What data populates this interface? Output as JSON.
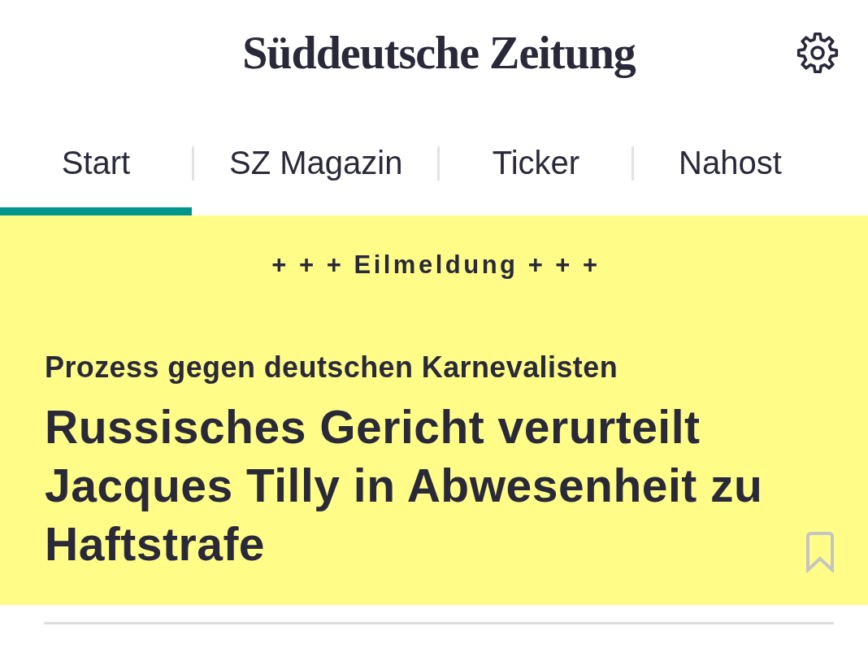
{
  "header": {
    "logo": "Süddeutsche Zeitung"
  },
  "tabs": [
    {
      "label": "Start",
      "selected": true
    },
    {
      "label": "SZ Magazin",
      "selected": false
    },
    {
      "label": "Ticker",
      "selected": false
    },
    {
      "label": "Nahost",
      "selected": false
    }
  ],
  "breaking_news": {
    "banner": "+ + + Eilmeldung + + +",
    "kicker": "Prozess gegen deutschen Karnevalisten",
    "headline": "Russisches Gericht verurteilt Jacques Tilly in Abwesenheit zu Haftstrafe",
    "bookmarked": false
  }
}
